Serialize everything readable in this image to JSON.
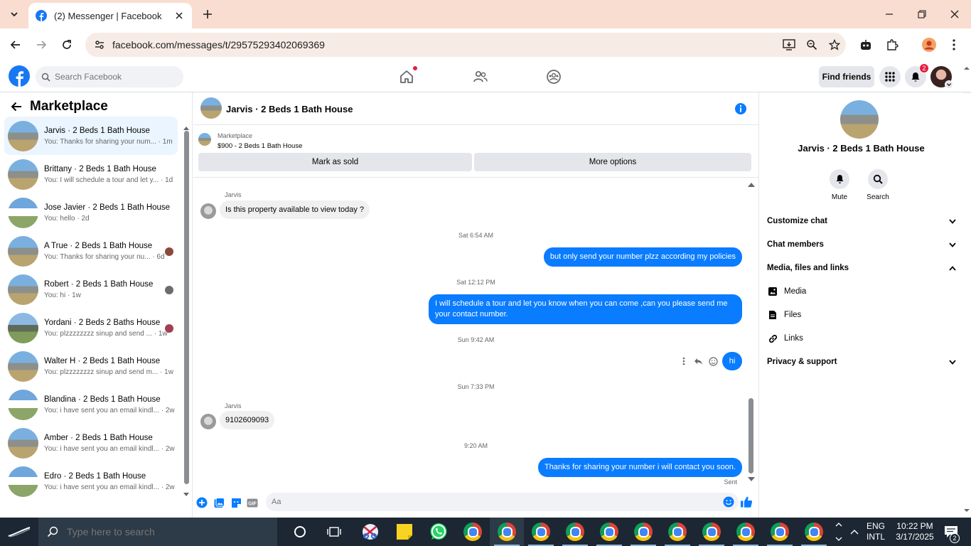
{
  "browser": {
    "tab_title": "(2) Messenger | Facebook",
    "url": "facebook.com/messages/t/29575293402069369"
  },
  "fb": {
    "search_placeholder": "Search Facebook",
    "find_friends": "Find friends",
    "notif_count": "2"
  },
  "left": {
    "title": "Marketplace",
    "conversations": [
      {
        "name": "Jarvis · 2 Beds 1 Bath House",
        "preview": "You: Thanks for sharing your num... · 1m"
      },
      {
        "name": "Brittany · 2 Beds 1 Bath House",
        "preview": "You: I will schedule a tour and let y... · 1d"
      },
      {
        "name": "Jose Javier · 2 Beds 1 Bath House",
        "preview": "You: hello · 2d"
      },
      {
        "name": "A True · 2 Beds 1 Bath House",
        "preview": "You: Thanks for sharing your nu... · 6d"
      },
      {
        "name": "Robert · 2 Beds 1 Bath House",
        "preview": "You: hi · 1w"
      },
      {
        "name": "Yordani · 2 Beds 2 Baths House",
        "preview": "You: plzzzzzzzz sinup and send ... · 1w"
      },
      {
        "name": "Walter H · 2 Beds 1 Bath House",
        "preview": "You: plzzzzzzzz sinup and send m... · 1w"
      },
      {
        "name": "Blandina · 2 Beds 1 Bath House",
        "preview": "You: i have sent you an email kindl... · 2w"
      },
      {
        "name": "Amber · 2 Beds 1 Bath House",
        "preview": "You: i have sent you an email kindl... · 2w"
      },
      {
        "name": "Edro · 2 Beds 1 Bath House",
        "preview": "You: i have sent you an email kindl... · 2w"
      }
    ]
  },
  "chat": {
    "title": "Jarvis · 2 Beds 1 Bath House",
    "marketplace_label": "Marketplace",
    "listing": "$900 - 2 Beds 1 Bath House",
    "mark_sold": "Mark as sold",
    "more_options": "More options",
    "sender1": "Jarvis",
    "msg1": "Is this property available to view today ?",
    "ts1": "Sat 6:54 AM",
    "msg2": "but only send your number plzz according my policies",
    "ts2": "Sat 12:12 PM",
    "msg3": "I will schedule a tour and let you know when you can come ,can you please send me your contact number.",
    "ts3": "Sun 9:42 AM",
    "msg4": "hi",
    "ts4": "Sun 7:33 PM",
    "sender2": "Jarvis",
    "msg5": "9102609093",
    "ts5": "9:20 AM",
    "msg6": "Thanks for sharing your number i will contact you soon.",
    "sent": "Sent",
    "composer_placeholder": "Aa"
  },
  "right": {
    "name": "Jarvis · 2 Beds 1 Bath House",
    "mute": "Mute",
    "search": "Search",
    "customize": "Customize chat",
    "members": "Chat members",
    "media_files": "Media, files and links",
    "media": "Media",
    "files": "Files",
    "links": "Links",
    "privacy": "Privacy & support"
  },
  "taskbar": {
    "search_placeholder": "Type here to search",
    "lang1": "ENG",
    "lang2": "INTL",
    "time": "10:22 PM",
    "date": "3/17/2025",
    "notif_count": "2"
  },
  "colors": {
    "messenger_blue": "#0a7cff",
    "fb_blue": "#1877f2",
    "tab_strip": "#f9ddd0"
  }
}
